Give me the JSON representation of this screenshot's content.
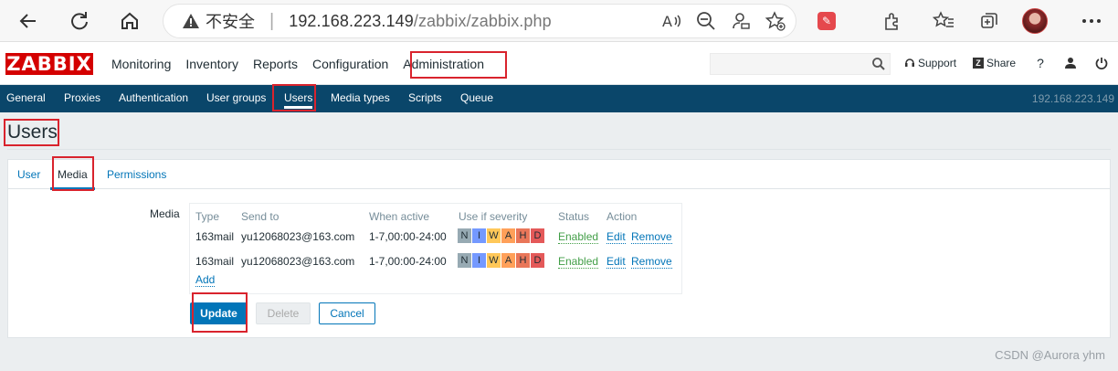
{
  "browser": {
    "insecure_label": "不安全",
    "url_host": "192.168.223.149",
    "url_path": "/zabbix/zabbix.php"
  },
  "app": {
    "logo": "ZABBIX",
    "main_menu": [
      "Monitoring",
      "Inventory",
      "Reports",
      "Configuration",
      "Administration"
    ],
    "support": "Support",
    "share": "Share",
    "help": "?",
    "server_name": "192.168.223.149"
  },
  "sub_menu": [
    "General",
    "Proxies",
    "Authentication",
    "User groups",
    "Users",
    "Media types",
    "Scripts",
    "Queue"
  ],
  "page": {
    "title": "Users",
    "tabs": [
      "User",
      "Media",
      "Permissions"
    ]
  },
  "media": {
    "label": "Media",
    "headers": [
      "Type",
      "Send to",
      "When active",
      "Use if severity",
      "Status",
      "Action"
    ],
    "rows": [
      {
        "type": "163mail",
        "send_to": "yu12068023@163.com",
        "when_active": "1-7,00:00-24:00",
        "status": "Enabled",
        "edit": "Edit",
        "remove": "Remove"
      },
      {
        "type": "163mail",
        "send_to": "yu12068023@163.com",
        "when_active": "1-7,00:00-24:00",
        "status": "Enabled",
        "edit": "Edit",
        "remove": "Remove"
      }
    ],
    "severity_letters": [
      "N",
      "I",
      "W",
      "A",
      "H",
      "D"
    ],
    "severity_colors": [
      "#97aab3",
      "#7499ff",
      "#ffc859",
      "#ffa059",
      "#e97659",
      "#e45959"
    ],
    "add": "Add"
  },
  "buttons": {
    "update": "Update",
    "delete": "Delete",
    "cancel": "Cancel"
  },
  "watermark": "CSDN @Aurora yhm"
}
